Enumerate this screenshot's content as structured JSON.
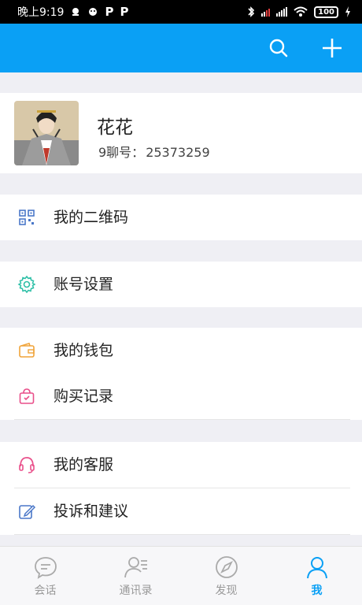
{
  "status_bar": {
    "time": "晚上9:19",
    "left_glyphs": [
      "P",
      "P"
    ],
    "battery": "100"
  },
  "header": {
    "accent_color": "#0aa0f5",
    "icons": [
      "search-icon",
      "plus-icon"
    ]
  },
  "profile": {
    "name": "花花",
    "id_label": "9聊号：",
    "id_value": "25373259"
  },
  "menu": {
    "qrcode": "我的二维码",
    "account_settings": "账号设置",
    "wallet": "我的钱包",
    "purchase_history": "购买记录",
    "customer_service": "我的客服",
    "feedback": "投诉和建议"
  },
  "tabs": [
    {
      "label": "会话",
      "icon": "chat-icon"
    },
    {
      "label": "通讯录",
      "icon": "contacts-icon"
    },
    {
      "label": "发现",
      "icon": "compass-icon"
    },
    {
      "label": "我",
      "icon": "person-icon",
      "active": true
    }
  ]
}
